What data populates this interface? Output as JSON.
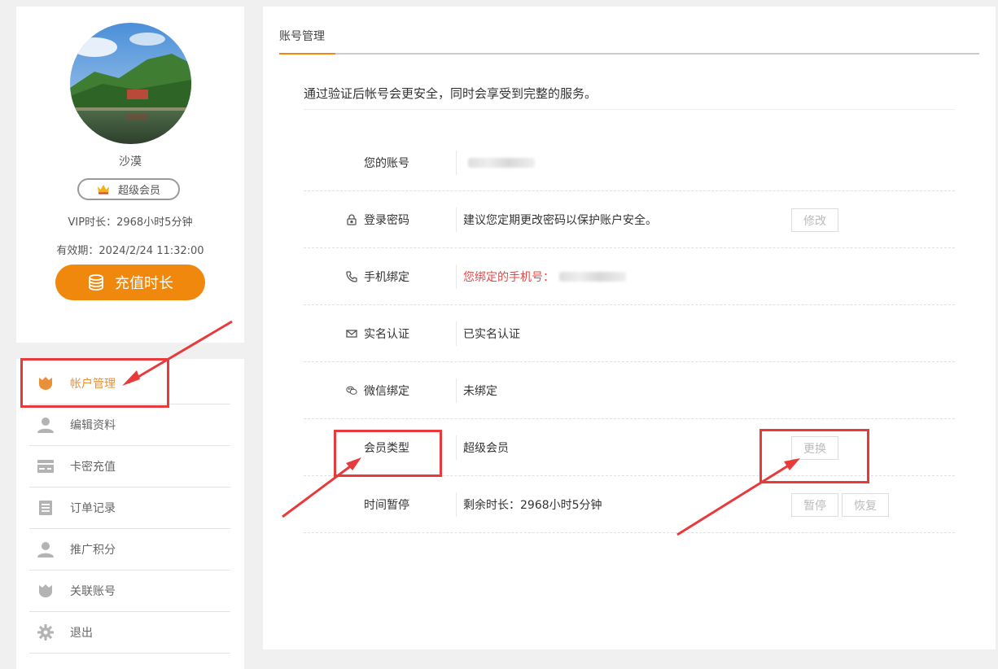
{
  "profile": {
    "username": "沙漠",
    "member_badge": "超级会员",
    "vip_duration": "VIP时长：2968小时5分钟",
    "expire": "有效期：2024/2/24 11:32:00",
    "recharge_label": "充值时长"
  },
  "menu": {
    "items": [
      {
        "label": "帐户管理",
        "icon": "shield-icon",
        "active": true
      },
      {
        "label": "编辑资料",
        "icon": "user-icon"
      },
      {
        "label": "卡密充值",
        "icon": "card-icon"
      },
      {
        "label": "订单记录",
        "icon": "list-icon"
      },
      {
        "label": "推广积分",
        "icon": "user-icon"
      },
      {
        "label": "关联账号",
        "icon": "shield-icon"
      },
      {
        "label": "退出",
        "icon": "gear-icon"
      }
    ]
  },
  "main": {
    "tab_label": "账号管理",
    "intro": "通过验证后帐号会更安全，同时会享受到完整的服务。",
    "rows": [
      {
        "label": "您的账号",
        "value": ""
      },
      {
        "label": "登录密码",
        "icon": "lock-icon",
        "value": "建议您定期更改密码以保护账户安全。",
        "button": "修改"
      },
      {
        "label": "手机绑定",
        "icon": "phone-icon",
        "value": "您绑定的手机号："
      },
      {
        "label": "实名认证",
        "icon": "mail-icon",
        "value": "已实名认证"
      },
      {
        "label": "微信绑定",
        "icon": "wechat-icon",
        "value": "未绑定"
      },
      {
        "label": "会员类型",
        "value": "超级会员",
        "button": "更换"
      },
      {
        "label": "时间暂停",
        "value": "剩余时长：2968小时5分钟",
        "button": "暂停",
        "button2": "恢复"
      }
    ]
  },
  "colors": {
    "accent": "#f0880e",
    "annotation": "#e8393b",
    "phone_text": "#e04b4b"
  }
}
